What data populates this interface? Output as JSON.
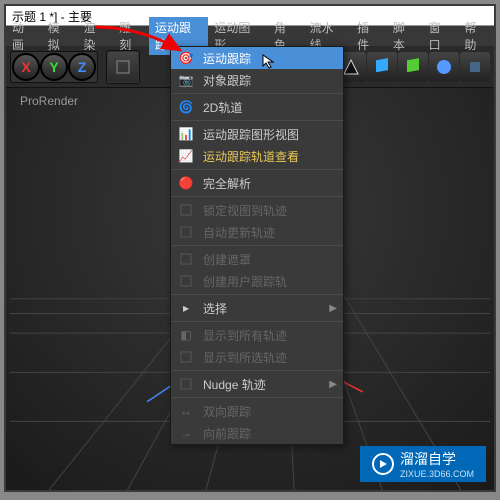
{
  "window": {
    "title": "示题 1 *] - 主要"
  },
  "menubar": {
    "items": [
      "动画",
      "模拟",
      "渲染",
      "雕刻",
      "运动跟踪",
      "运动图形",
      "角色",
      "流水线",
      "插件",
      "脚本",
      "窗口",
      "帮助"
    ],
    "activeIndex": 4
  },
  "toolbar": {
    "axes": {
      "x": "X",
      "y": "Y",
      "z": "Z"
    }
  },
  "viewportLabel": "ProRender",
  "dropdown": {
    "items": [
      {
        "label": "运动跟踪",
        "icon": "🎯",
        "hl": true
      },
      {
        "label": "对象跟踪",
        "icon": "📷"
      },
      {
        "sep": true
      },
      {
        "label": "2D轨道",
        "icon": "🌀"
      },
      {
        "sep": true
      },
      {
        "label": "运动跟踪图形视图",
        "icon": "📊"
      },
      {
        "label": "运动跟踪轨道查看",
        "icon": "📈",
        "yellow": true
      },
      {
        "sep": true
      },
      {
        "label": "完全解析",
        "icon": "🔴"
      },
      {
        "sep": true
      },
      {
        "label": "锁定视图到轨迹",
        "dis": true
      },
      {
        "label": "自动更新轨迹",
        "dis": true
      },
      {
        "sep": true
      },
      {
        "label": "创建遮罩",
        "dis": true
      },
      {
        "label": "创建用户跟踪轨",
        "dis": true
      },
      {
        "sep": true
      },
      {
        "label": "选择",
        "icon": "▸",
        "sub": true
      },
      {
        "sep": true
      },
      {
        "label": "显示到所有轨迹",
        "icon": "◧",
        "dis": true
      },
      {
        "label": "显示到所选轨迹",
        "dis": true
      },
      {
        "sep": true
      },
      {
        "label": "Nudge 轨迹",
        "sub": true
      },
      {
        "sep": true
      },
      {
        "label": "双向跟踪",
        "icon": "↔",
        "dis": true
      },
      {
        "label": "向前跟踪",
        "icon": "→",
        "dis": true
      }
    ]
  },
  "watermark": {
    "brand": "溜溜自学",
    "url": "ZIXUE.3D66.COM"
  }
}
